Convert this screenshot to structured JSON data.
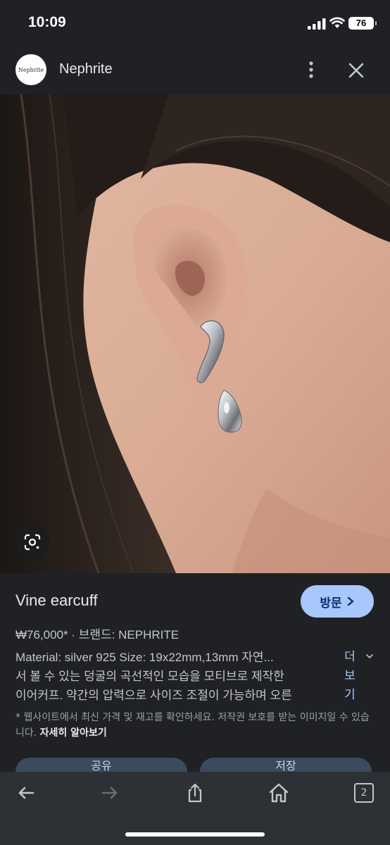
{
  "status": {
    "time": "10:09",
    "battery": "76"
  },
  "header": {
    "site_name": "Nephrite",
    "logo_text": "Nephrite"
  },
  "product": {
    "title": "Vine earcuff",
    "visit_label": "방문",
    "meta": "₩76,000* · 브랜드: NEPHRITE",
    "description_lines": [
      "Material: silver 925 Size: 19x22mm,13mm 자연...",
      "서 볼 수 있는 덩굴의 곡선적인 모습을 모티브로 제작한",
      "이어커프. 약간의 압력으로 사이즈 조절이 가능하며 오른"
    ],
    "more_label": "더보기",
    "note": "* 웹사이트에서 최신 가격 및 재고를 확인하세요. 저작권 보호를 받는 이미지일 수 있습니다.",
    "note_link": "자세히 알아보기",
    "share_label": "공유",
    "save_label": "저장"
  },
  "browser": {
    "tab_count": "2"
  },
  "icons": [
    "signal-icon",
    "wifi-icon",
    "battery-icon",
    "more-vert-icon",
    "close-icon",
    "google-lens-icon",
    "chevron-right-icon",
    "chevron-down-icon",
    "back-arrow-icon",
    "forward-arrow-icon",
    "share-icon",
    "home-icon",
    "tabs-icon"
  ],
  "colors": {
    "background": "#1f2125",
    "accent": "#a8c7fa",
    "toolbar": "#2d3035"
  }
}
